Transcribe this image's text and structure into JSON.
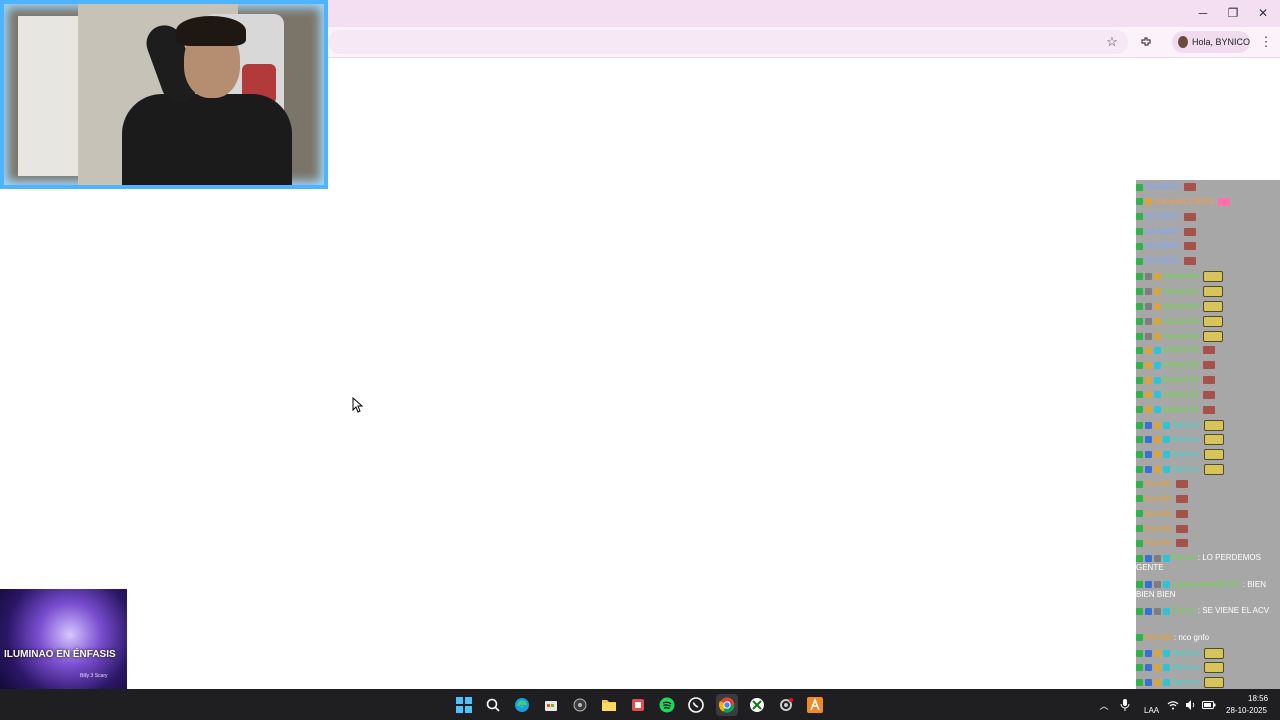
{
  "browser": {
    "window_controls": {
      "minimize": "─",
      "restore": "❐",
      "close": "✕"
    },
    "profile_label": "Hola, BYNICO"
  },
  "colors": {
    "titlebar": "#f4dff2",
    "toolbar": "#fbf2fa",
    "webcam_border": "#4fb4ff",
    "chat_bg": "#a7a7a7",
    "taskbar": "#1f1f22"
  },
  "chat": {
    "messages": [
      {
        "user": "NEAMATI",
        "user_color": "#7aa7ff",
        "text": "",
        "badges": [
          "green"
        ],
        "emote": "red"
      },
      {
        "user": "ImKopelCCIERG",
        "user_color": "#ff9a44",
        "text": "",
        "badges": [
          "green",
          "gold"
        ],
        "emote": "pink"
      },
      {
        "user": "NEAMATI",
        "user_color": "#7aa7ff",
        "text": "",
        "badges": [
          "green"
        ],
        "emote": "red"
      },
      {
        "user": "NEAMATI",
        "user_color": "#7aa7ff",
        "text": "",
        "badges": [
          "green"
        ],
        "emote": "red"
      },
      {
        "user": "NEAMATI",
        "user_color": "#7aa7ff",
        "text": "",
        "badges": [
          "green"
        ],
        "emote": "red"
      },
      {
        "user": "NEAMATI",
        "user_color": "#7aa7ff",
        "text": "",
        "badges": [
          "green"
        ],
        "emote": "red"
      },
      {
        "user": "diacaysob",
        "user_color": "#6fd84a",
        "text": "",
        "badges": [
          "green",
          "gray",
          "gold"
        ],
        "emote": "wide"
      },
      {
        "user": "diacaysob",
        "user_color": "#6fd84a",
        "text": "",
        "badges": [
          "green",
          "gray",
          "gold"
        ],
        "emote": "wide"
      },
      {
        "user": "diacaysob",
        "user_color": "#6fd84a",
        "text": "",
        "badges": [
          "green",
          "gray",
          "gold"
        ],
        "emote": "wide"
      },
      {
        "user": "diacaysob",
        "user_color": "#6fd84a",
        "text": "",
        "badges": [
          "green",
          "gray",
          "gold"
        ],
        "emote": "wide"
      },
      {
        "user": "diacaysob",
        "user_color": "#6fd84a",
        "text": "",
        "badges": [
          "green",
          "gray",
          "gold"
        ],
        "emote": "wide"
      },
      {
        "user": "wollas133",
        "user_color": "#6fd84a",
        "text": "",
        "badges": [
          "green",
          "gold",
          "cyan"
        ],
        "emote": "red"
      },
      {
        "user": "wollas133",
        "user_color": "#6fd84a",
        "text": "",
        "badges": [
          "green",
          "gold",
          "cyan"
        ],
        "emote": "red"
      },
      {
        "user": "wollas133",
        "user_color": "#6fd84a",
        "text": "",
        "badges": [
          "green",
          "gold",
          "cyan"
        ],
        "emote": "red"
      },
      {
        "user": "wollas133",
        "user_color": "#6fd84a",
        "text": "",
        "badges": [
          "green",
          "gold",
          "cyan"
        ],
        "emote": "red"
      },
      {
        "user": "wollas133",
        "user_color": "#6fd84a",
        "text": "",
        "badges": [
          "green",
          "gold",
          "cyan"
        ],
        "emote": "red"
      },
      {
        "user": "Nachou",
        "user_color": "#3fd6c9",
        "text": "",
        "badges": [
          "green",
          "blue",
          "gold",
          "cyan"
        ],
        "emote": "wide"
      },
      {
        "user": "Nachou",
        "user_color": "#3fd6c9",
        "text": "",
        "badges": [
          "green",
          "blue",
          "gold",
          "cyan"
        ],
        "emote": "wide"
      },
      {
        "user": "Nachou",
        "user_color": "#3fd6c9",
        "text": "",
        "badges": [
          "green",
          "blue",
          "gold",
          "cyan"
        ],
        "emote": "wide"
      },
      {
        "user": "Nachou",
        "user_color": "#3fd6c9",
        "text": "",
        "badges": [
          "green",
          "blue",
          "gold",
          "cyan"
        ],
        "emote": "wide"
      },
      {
        "user": "Kunollo",
        "user_color": "#e9a22a",
        "text": "",
        "badges": [
          "green"
        ],
        "emote": "red"
      },
      {
        "user": "Kunollo",
        "user_color": "#e9a22a",
        "text": "",
        "badges": [
          "green"
        ],
        "emote": "red"
      },
      {
        "user": "Kunollo",
        "user_color": "#e9a22a",
        "text": "",
        "badges": [
          "green"
        ],
        "emote": "red"
      },
      {
        "user": "Kunollo",
        "user_color": "#e9a22a",
        "text": "",
        "badges": [
          "green"
        ],
        "emote": "red"
      },
      {
        "user": "Kunollo",
        "user_color": "#e9a22a",
        "text": "",
        "badges": [
          "green"
        ],
        "emote": "red"
      }
    ],
    "long_messages": [
      {
        "user": "Faccio",
        "user_color": "#6fd84a",
        "text": ": LO PERDEMOS GENTE"
      },
      {
        "user": "LyjindroxnestRLEG",
        "user_color": "#6fd84a",
        "text": ": BIEN BIEN BIEN"
      },
      {
        "user": "Faccio",
        "user_color": "#6fd84a",
        "text": ": SE VIENE EL ACV"
      }
    ],
    "tail_messages": [
      {
        "user": "Kunollo",
        "user_color": "#e9a22a",
        "text": ": nco gnfo"
      },
      {
        "user": "Nachou",
        "user_color": "#3fd6c9",
        "text": ""
      },
      {
        "user": "Nachou",
        "user_color": "#3fd6c9",
        "text": ""
      },
      {
        "user": "Nachou",
        "user_color": "#3fd6c9",
        "text": ""
      },
      {
        "user": "Nachou",
        "user_color": "#3fd6c9",
        "text": ":"
      }
    ]
  },
  "album": {
    "title": "ILUMINAO EN ÉNFASIS",
    "artist": "Billy 3 Scary"
  },
  "taskbar": {
    "language": "LAA",
    "time": "18:56",
    "date": "28-10-2025"
  }
}
